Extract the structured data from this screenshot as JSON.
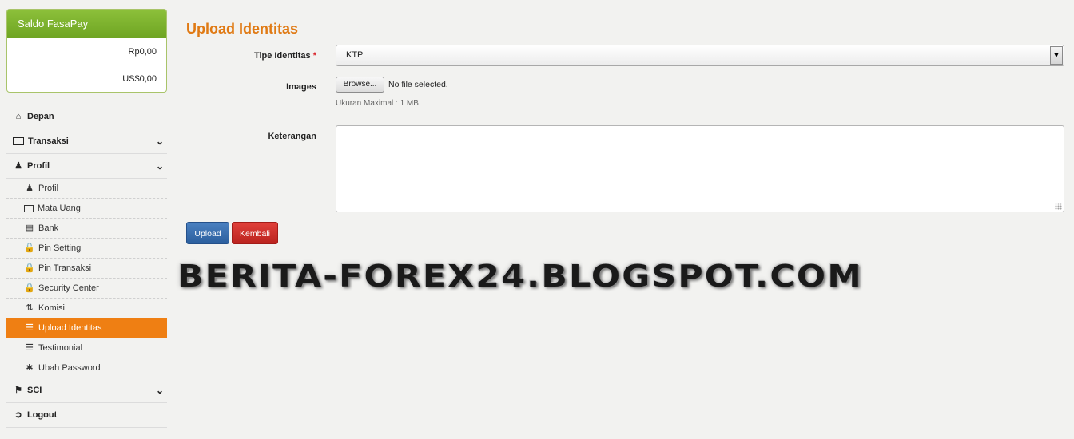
{
  "balance": {
    "title": "Saldo FasaPay",
    "rows": [
      "Rp0,00",
      "US$0,00"
    ]
  },
  "nav": {
    "depan": "Depan",
    "transaksi": "Transaksi",
    "profil": "Profil",
    "profil_items": [
      "Profil",
      "Mata Uang",
      "Bank",
      "Pin Setting",
      "Pin Transaksi",
      "Security Center",
      "Komisi",
      "Upload Identitas",
      "Testimonial",
      "Ubah Password"
    ],
    "active_item": "Upload Identitas",
    "sci": "SCI",
    "logout": "Logout"
  },
  "form": {
    "title": "Upload Identitas",
    "tipe_label": "Tipe Identitas",
    "required_mark": "*",
    "tipe_value": "KTP",
    "images_label": "Images",
    "browse_label": "Browse...",
    "file_status": "No file selected.",
    "hint": "Ukuran Maximal : 1 MB",
    "keterangan_label": "Keterangan",
    "upload_button": "Upload",
    "back_button": "Kembali"
  },
  "watermark": "BERITA-FOREX24.BLOGSPOT.COM",
  "colors": {
    "accent_orange": "#ef7f13",
    "title_orange": "#e07a14",
    "balance_green": "#7ab02c",
    "upload_blue": "#2b5f9e",
    "back_red": "#bb231e"
  },
  "icons": {
    "depan": "home-icon",
    "transaksi": "money-icon",
    "profil": "user-icon",
    "sci": "tags-icon",
    "logout": "logout-icon"
  }
}
